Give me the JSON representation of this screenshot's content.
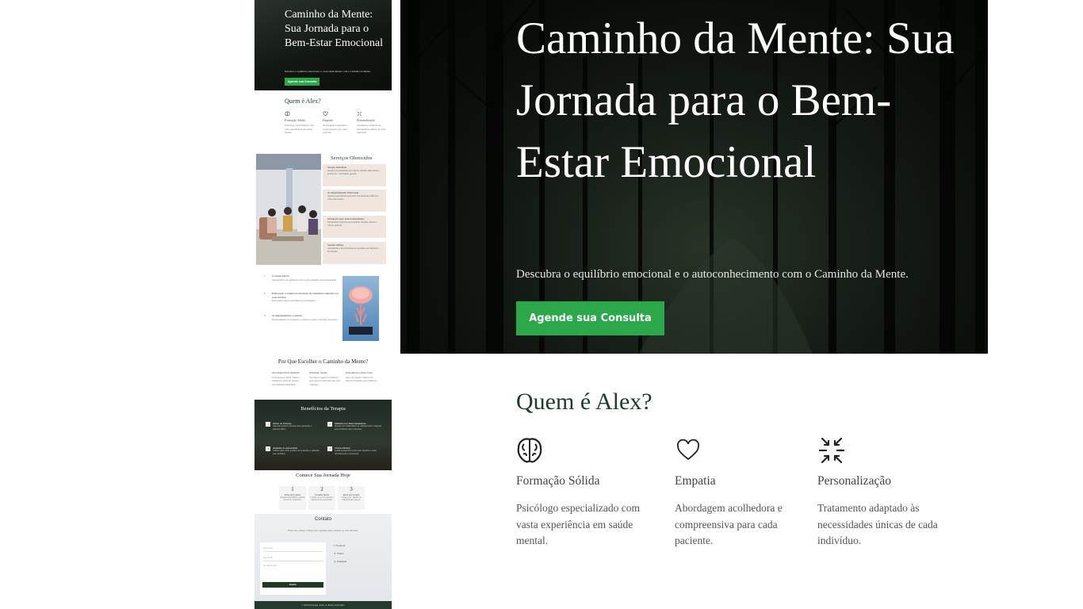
{
  "hero": {
    "title": "Caminho da Mente: Sua Jornada para o Bem-Estar Emocional",
    "subtitle": "Descubra o equilíbrio emocional e o autoconhecimento com o Caminho da Mente.",
    "cta_label": "Agende sua Consulta"
  },
  "about": {
    "title": "Quem é Alex?",
    "features": [
      {
        "icon": "brain-icon",
        "title": "Formação Sólida",
        "desc": "Psicólogo especializado com vasta experiência em saúde mental."
      },
      {
        "icon": "heart-icon",
        "title": "Empatia",
        "desc": "Abordagem acolhedora e compreensiva para cada paciente."
      },
      {
        "icon": "arrows-inward-icon",
        "title": "Personalização",
        "desc": "Tratamento adaptado às necessidades únicas de cada indivíduo."
      }
    ]
  },
  "thumbnail": {
    "services": {
      "title": "Serviços Oferecidos",
      "cards": [
        {
          "title": "Terapia Individual",
          "desc": "Sessões personalizadas para superar desafios emocionais e promover o crescimento pessoal."
        },
        {
          "title": "Acompanhamento Emocional",
          "desc": "Suporte especializado para lidar com momentos difíceis e crises emocionais."
        },
        {
          "title": "Orientação para Autoconhecimento",
          "desc": "Ferramentas e técnicas para explorar emoções, medos e valores pessoais."
        },
        {
          "title": "Sessões Online",
          "desc": "Atendimento virtual flexível para pacientes em diferentes localidades."
        }
      ]
    },
    "steps": [
      {
        "num": "1",
        "title": "Consulta Inicial",
        "desc": "Apresentação dos primeiros passos para entender suas necessidades."
      },
      {
        "num": "2",
        "title": "Elaboração Conjunta de um plano de tratamento adaptado aos seus desafios",
        "desc": "Elaboramos juntos estratégias de crescimento."
      },
      {
        "num": "3",
        "title": "Acompanhamento Contínuo",
        "desc": "Monitoramento do progresso e ajustes no plano conforme necessário."
      }
    ],
    "why": {
      "title": "Por Que Escolher o Caminho da Mente?",
      "items": [
        {
          "title": "Abordagem Personalizada",
          "desc": "Cada pessoa é única. Ofereço tratamento adaptado às suas necessidades individuais."
        },
        {
          "title": "Ambiente Seguro",
          "desc": "Um espaço seguro e acolhedor para explorar suas emoções com confiança."
        },
        {
          "title": "Experiência Comprovada",
          "desc": "Anos de atuação clínica com técnicas baseadas em evidências."
        }
      ]
    },
    "benefits": {
      "title": "Benefícios da Terapia",
      "items": [
        {
          "num": "1",
          "title": "Alívio do Estresse",
          "desc": "Aprenda técnicas eficazes para gerenciar o estresse diário."
        },
        {
          "num": "2",
          "title": "Melhoria nos Relacionamentos",
          "desc": "Desenvolva habilidades de comunicação e empatia para fortalecer suas conexões."
        },
        {
          "num": "3",
          "title": "Aumento da Autoestima",
          "desc": "Cultive uma visão positiva de si mesmo e aumente sua confiança."
        },
        {
          "num": "4",
          "title": "Clareza Mental",
          "desc": "Ganhe perspectiva sobre seus desafios e tome decisões mais conscientes."
        }
      ]
    },
    "journey": {
      "title": "Comece Sua Jornada Hoje",
      "steps": [
        {
          "num": "1",
          "title": "Entre em Contato",
          "desc": "Agende sua primeira consulta através do formulário."
        },
        {
          "num": "2",
          "title": "Consulta Inicial",
          "desc": "Conheça nossa abordagem e discuta suas necessidades."
        },
        {
          "num": "3",
          "title": "Inicie sua Jornada",
          "desc": "Comece seu caminho de transformação pessoal."
        }
      ]
    },
    "contact": {
      "title": "Contato",
      "subtitle": "Entre em contato comigo para agendar uma consulta ou tirar dúvidas.",
      "name_placeholder": "Seu Nome",
      "email_placeholder": "Seu Email",
      "message_placeholder": "Sua Mensagem",
      "send_label": "Enviar",
      "social": [
        "Facebook",
        "Twitter",
        "Instagram"
      ]
    },
    "footer": "© 2024 Psicologia. Todos os direitos reservados."
  },
  "colors": {
    "accent_green": "#2aa84a",
    "heading_green": "#1f3b2a",
    "footer_green": "#243a2c"
  }
}
